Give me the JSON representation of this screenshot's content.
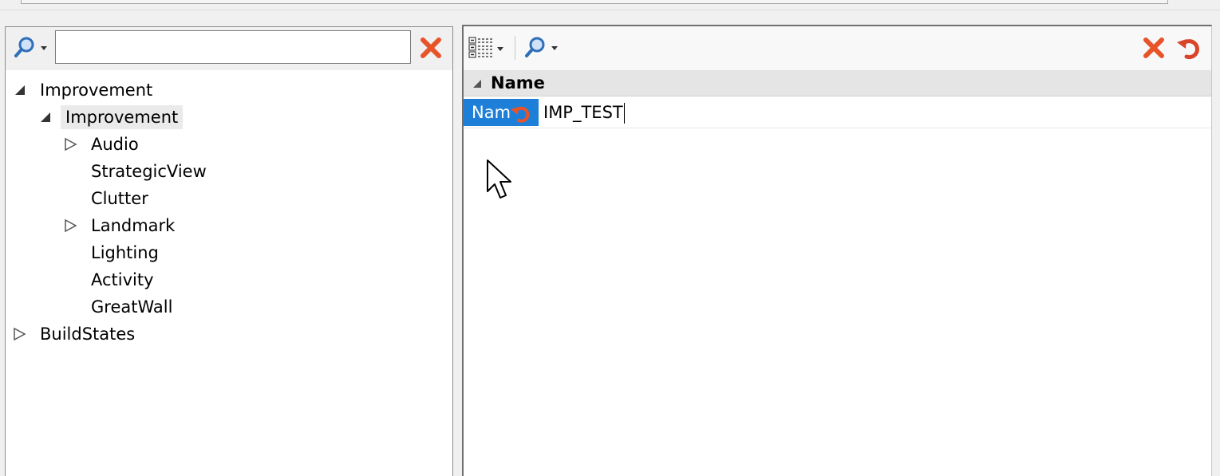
{
  "left_panel": {
    "search_value": "",
    "tree": [
      {
        "label": "Improvement",
        "level": 0,
        "expander": "expanded",
        "selected": false
      },
      {
        "label": "Improvement",
        "level": 1,
        "expander": "expanded",
        "selected": true
      },
      {
        "label": "Audio",
        "level": 2,
        "expander": "collapsed",
        "selected": false
      },
      {
        "label": "StrategicView",
        "level": 2,
        "expander": "none",
        "selected": false
      },
      {
        "label": "Clutter",
        "level": 2,
        "expander": "none",
        "selected": false
      },
      {
        "label": "Landmark",
        "level": 2,
        "expander": "collapsed",
        "selected": false
      },
      {
        "label": "Lighting",
        "level": 2,
        "expander": "none",
        "selected": false
      },
      {
        "label": "Activity",
        "level": 2,
        "expander": "none",
        "selected": false
      },
      {
        "label": "GreatWall",
        "level": 2,
        "expander": "none",
        "selected": false
      },
      {
        "label": "BuildStates",
        "level": 0,
        "expander": "collapsed",
        "selected": false
      }
    ]
  },
  "right_panel": {
    "column_header": "Name",
    "property": {
      "name_label": "Nam",
      "value": "IMP_TEST"
    }
  },
  "colors": {
    "accent_blue": "#1e7fd8",
    "clear_red": "#e8542a",
    "undo_red": "#d9452b",
    "search_blue": "#2f6fb8"
  },
  "icons": {
    "search": "magnifier-icon",
    "clear": "red-x-icon",
    "undo": "undo-arrow-icon",
    "grid_view": "property-grid-icon"
  }
}
